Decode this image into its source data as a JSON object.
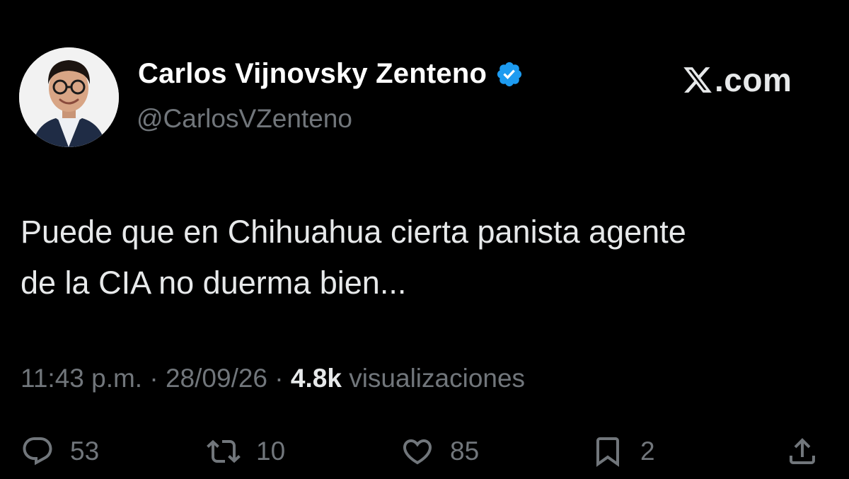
{
  "author": {
    "display_name": "Carlos Vijnovsky Zenteno",
    "handle": "@CarlosVZenteno",
    "verified": true,
    "verified_color": "#1d9bf0"
  },
  "brand": {
    "domain": ".com",
    "logo_icon": "x-logo-icon"
  },
  "tweet": {
    "text_line1": "Puede que en Chihuahua cierta panista agente",
    "text_line2": "de la CIA no duerma bien..."
  },
  "meta": {
    "time": "11:43 p.m.",
    "separator": "·",
    "date": "28/09/26",
    "views_count": "4.8k",
    "views_label": "visualizaciones"
  },
  "actions": {
    "replies": "53",
    "retweets": "10",
    "likes": "85",
    "bookmarks": "2"
  },
  "colors": {
    "background": "#000000",
    "primary_text": "#e7e9ea",
    "secondary_text": "#71767b"
  }
}
